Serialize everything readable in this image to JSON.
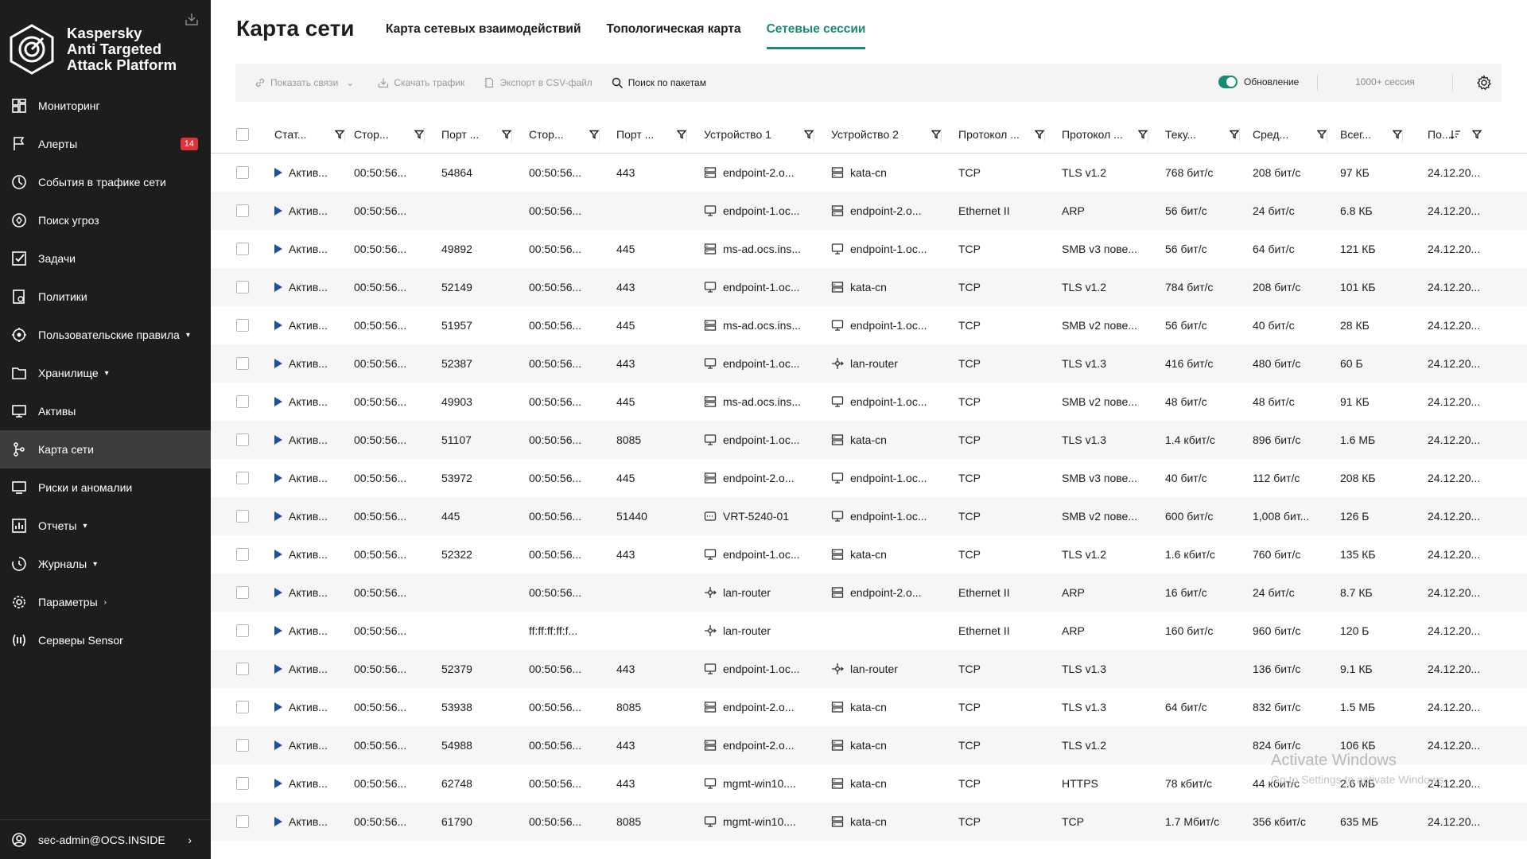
{
  "sidebar": {
    "brand_line1": "Kaspersky",
    "brand_line2": "Anti Targeted",
    "brand_line3": "Attack Platform",
    "items": [
      {
        "label": "Мониторинг",
        "icon": "dashboard-icon"
      },
      {
        "label": "Алерты",
        "icon": "flag-icon",
        "badge": "14"
      },
      {
        "label": "События в трафике сети",
        "icon": "traffic-icon"
      },
      {
        "label": "Поиск угроз",
        "icon": "threat-search-icon"
      },
      {
        "label": "Задачи",
        "icon": "task-check-icon"
      },
      {
        "label": "Политики",
        "icon": "policy-icon"
      },
      {
        "label": "Пользовательские правила",
        "icon": "rules-icon",
        "chevron": "down"
      },
      {
        "label": "Хранилище",
        "icon": "folder-icon",
        "chevron": "down"
      },
      {
        "label": "Активы",
        "icon": "monitor-icon"
      },
      {
        "label": "Карта сети",
        "icon": "network-map-icon",
        "active": true
      },
      {
        "label": "Риски и аномалии",
        "icon": "risk-monitor-icon"
      },
      {
        "label": "Отчеты",
        "icon": "report-icon",
        "chevron": "down"
      },
      {
        "label": "Журналы",
        "icon": "journal-icon",
        "chevron": "down"
      },
      {
        "label": "Параметры",
        "icon": "gear-icon",
        "chevron": "right"
      },
      {
        "label": "Серверы Sensor",
        "icon": "sensor-icon"
      }
    ],
    "user": "sec-admin@OCS.INSIDE"
  },
  "header": {
    "title": "Карта сети",
    "tabs": [
      {
        "label": "Карта сетевых взаимодействий"
      },
      {
        "label": "Топологическая карта"
      },
      {
        "label": "Сетевые сессии",
        "active": true
      }
    ]
  },
  "toolbar": {
    "show_links": "Показать связи",
    "download_traffic": "Скачать трафик",
    "export_csv": "Экспорт в CSV-файл",
    "packet_search": "Поиск по пакетам",
    "refresh_label": "Обновление",
    "sessions_count": "1000+ сессия"
  },
  "table": {
    "columns": [
      "Стат...",
      "Стор...",
      "Порт ...",
      "Стор...",
      "Порт ...",
      "Устройство 1",
      "Устройство 2",
      "Протокол ...",
      "Протокол ...",
      "Теку...",
      "Сред...",
      "Всег...",
      "По..."
    ],
    "rows": [
      {
        "status": "Актив...",
        "t1": "00:50:56...",
        "p1": "54864",
        "t2": "00:50:56...",
        "p2": "443",
        "d1": "endpoint-2.o...",
        "d1i": "server",
        "d2": "kata-cn",
        "d2i": "server",
        "proto": "TCP",
        "app": "TLS v1.2",
        "cur": "768 бит/с",
        "avg": "208 бит/с",
        "total": "97 КБ",
        "date": "24.12.20..."
      },
      {
        "status": "Актив...",
        "t1": "00:50:56...",
        "p1": "",
        "t2": "00:50:56...",
        "p2": "",
        "d1": "endpoint-1.oc...",
        "d1i": "monitor",
        "d2": "endpoint-2.o...",
        "d2i": "server",
        "proto": "Ethernet II",
        "app": "ARP",
        "cur": "56 бит/с",
        "avg": "24 бит/с",
        "total": "6.8 КБ",
        "date": "24.12.20..."
      },
      {
        "status": "Актив...",
        "t1": "00:50:56...",
        "p1": "49892",
        "t2": "00:50:56...",
        "p2": "445",
        "d1": "ms-ad.ocs.ins...",
        "d1i": "server",
        "d2": "endpoint-1.oc...",
        "d2i": "monitor",
        "proto": "TCP",
        "app": "SMB v3 пове...",
        "cur": "56 бит/с",
        "avg": "64 бит/с",
        "total": "121 КБ",
        "date": "24.12.20..."
      },
      {
        "status": "Актив...",
        "t1": "00:50:56...",
        "p1": "52149",
        "t2": "00:50:56...",
        "p2": "443",
        "d1": "endpoint-1.oc...",
        "d1i": "monitor",
        "d2": "kata-cn",
        "d2i": "server",
        "proto": "TCP",
        "app": "TLS v1.2",
        "cur": "784 бит/с",
        "avg": "208 бит/с",
        "total": "101 КБ",
        "date": "24.12.20..."
      },
      {
        "status": "Актив...",
        "t1": "00:50:56...",
        "p1": "51957",
        "t2": "00:50:56...",
        "p2": "445",
        "d1": "ms-ad.ocs.ins...",
        "d1i": "server",
        "d2": "endpoint-1.oc...",
        "d2i": "monitor",
        "proto": "TCP",
        "app": "SMB v2 пове...",
        "cur": "56 бит/с",
        "avg": "40 бит/с",
        "total": "28 КБ",
        "date": "24.12.20..."
      },
      {
        "status": "Актив...",
        "t1": "00:50:56...",
        "p1": "52387",
        "t2": "00:50:56...",
        "p2": "443",
        "d1": "endpoint-1.oc...",
        "d1i": "monitor",
        "d2": "lan-router",
        "d2i": "router",
        "proto": "TCP",
        "app": "TLS v1.3",
        "cur": "416 бит/с",
        "avg": "480 бит/с",
        "total": "60 Б",
        "date": "24.12.20..."
      },
      {
        "status": "Актив...",
        "t1": "00:50:56...",
        "p1": "49903",
        "t2": "00:50:56...",
        "p2": "445",
        "d1": "ms-ad.ocs.ins...",
        "d1i": "server",
        "d2": "endpoint-1.oc...",
        "d2i": "monitor",
        "proto": "TCP",
        "app": "SMB v2 пове...",
        "cur": "48 бит/с",
        "avg": "48 бит/с",
        "total": "91 КБ",
        "date": "24.12.20..."
      },
      {
        "status": "Актив...",
        "t1": "00:50:56...",
        "p1": "51107",
        "t2": "00:50:56...",
        "p2": "8085",
        "d1": "endpoint-1.oc...",
        "d1i": "monitor",
        "d2": "kata-cn",
        "d2i": "server",
        "proto": "TCP",
        "app": "TLS v1.3",
        "cur": "1.4 кбит/с",
        "avg": "896 бит/с",
        "total": "1.6 МБ",
        "date": "24.12.20..."
      },
      {
        "status": "Актив...",
        "t1": "00:50:56...",
        "p1": "53972",
        "t2": "00:50:56...",
        "p2": "445",
        "d1": "endpoint-2.o...",
        "d1i": "server",
        "d2": "endpoint-1.oc...",
        "d2i": "monitor",
        "proto": "TCP",
        "app": "SMB v3 пове...",
        "cur": "40 бит/с",
        "avg": "112 бит/с",
        "total": "208 КБ",
        "date": "24.12.20..."
      },
      {
        "status": "Актив...",
        "t1": "00:50:56...",
        "p1": "445",
        "t2": "00:50:56...",
        "p2": "51440",
        "d1": "VRT-5240-01",
        "d1i": "appliance",
        "d2": "endpoint-1.oc...",
        "d2i": "monitor",
        "proto": "TCP",
        "app": "SMB v2 пове...",
        "cur": "600 бит/с",
        "avg": "1,008 бит...",
        "total": "126 Б",
        "date": "24.12.20..."
      },
      {
        "status": "Актив...",
        "t1": "00:50:56...",
        "p1": "52322",
        "t2": "00:50:56...",
        "p2": "443",
        "d1": "endpoint-1.oc...",
        "d1i": "monitor",
        "d2": "kata-cn",
        "d2i": "server",
        "proto": "TCP",
        "app": "TLS v1.2",
        "cur": "1.6 кбит/с",
        "avg": "760 бит/с",
        "total": "135 КБ",
        "date": "24.12.20..."
      },
      {
        "status": "Актив...",
        "t1": "00:50:56...",
        "p1": "",
        "t2": "00:50:56...",
        "p2": "",
        "d1": "lan-router",
        "d1i": "router",
        "d2": "endpoint-2.o...",
        "d2i": "server",
        "proto": "Ethernet II",
        "app": "ARP",
        "cur": "16 бит/с",
        "avg": "24 бит/с",
        "total": "8.7 КБ",
        "date": "24.12.20..."
      },
      {
        "status": "Актив...",
        "t1": "00:50:56...",
        "p1": "",
        "t2": "ff:ff:ff:ff:f...",
        "p2": "",
        "d1": "lan-router",
        "d1i": "router",
        "d2": "",
        "d2i": "",
        "proto": "Ethernet II",
        "app": "ARP",
        "cur": "160 бит/с",
        "avg": "960 бит/с",
        "total": "120 Б",
        "date": "24.12.20..."
      },
      {
        "status": "Актив...",
        "t1": "00:50:56...",
        "p1": "52379",
        "t2": "00:50:56...",
        "p2": "443",
        "d1": "endpoint-1.oc...",
        "d1i": "monitor",
        "d2": "lan-router",
        "d2i": "router",
        "proto": "TCP",
        "app": "TLS v1.3",
        "cur": "",
        "avg": "136 бит/с",
        "total": "9.1 КБ",
        "date": "24.12.20..."
      },
      {
        "status": "Актив...",
        "t1": "00:50:56...",
        "p1": "53938",
        "t2": "00:50:56...",
        "p2": "8085",
        "d1": "endpoint-2.o...",
        "d1i": "server",
        "d2": "kata-cn",
        "d2i": "server",
        "proto": "TCP",
        "app": "TLS v1.3",
        "cur": "64 бит/с",
        "avg": "832 бит/с",
        "total": "1.5 МБ",
        "date": "24.12.20..."
      },
      {
        "status": "Актив...",
        "t1": "00:50:56...",
        "p1": "54988",
        "t2": "00:50:56...",
        "p2": "443",
        "d1": "endpoint-2.o...",
        "d1i": "server",
        "d2": "kata-cn",
        "d2i": "server",
        "proto": "TCP",
        "app": "TLS v1.2",
        "cur": "",
        "avg": "824 бит/с",
        "total": "106 КБ",
        "date": "24.12.20..."
      },
      {
        "status": "Актив...",
        "t1": "00:50:56...",
        "p1": "62748",
        "t2": "00:50:56...",
        "p2": "443",
        "d1": "mgmt-win10....",
        "d1i": "monitor",
        "d2": "kata-cn",
        "d2i": "server",
        "proto": "TCP",
        "app": "HTTPS",
        "cur": "78 кбит/с",
        "avg": "44 кбит/с",
        "total": "2.6 МБ",
        "date": "24.12.20..."
      },
      {
        "status": "Актив...",
        "t1": "00:50:56...",
        "p1": "61790",
        "t2": "00:50:56...",
        "p2": "8085",
        "d1": "mgmt-win10....",
        "d1i": "monitor",
        "d2": "kata-cn",
        "d2i": "server",
        "proto": "TCP",
        "app": "TCP",
        "cur": "1.7 Мбит/с",
        "avg": "356 кбит/с",
        "total": "635 МБ",
        "date": "24.12.20..."
      }
    ]
  },
  "watermark": {
    "line1": "Activate Windows",
    "line2": "Go to Settings to activate Windows."
  }
}
